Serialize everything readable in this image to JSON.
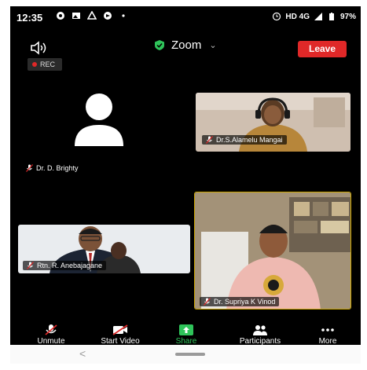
{
  "status_bar": {
    "time": "12:35",
    "right_text": "HD 4G",
    "battery": "97%",
    "icons": [
      "chat-bubble-icon",
      "gallery-icon",
      "drive-icon",
      "send-icon",
      "dot-icon",
      "alarm-icon",
      "signal-icon",
      "battery-icon"
    ]
  },
  "meeting": {
    "title": "Zoom",
    "leave_label": "Leave",
    "rec_label": "REC",
    "accent": "#e02828",
    "shield_color": "#2fc45a"
  },
  "participants": [
    {
      "name": "Dr. D. Brighty",
      "video": false
    },
    {
      "name": "Dr.S.Alamelu Mangai",
      "video": true
    },
    {
      "name": "Rtn. R. Anebajagane",
      "video": true
    },
    {
      "name": "Dr. Supriya K Vinod",
      "video": true,
      "active_speaker": true
    }
  ],
  "toolbar": {
    "unmute": "Unmute",
    "start_video": "Start Video",
    "share": "Share",
    "participants": "Participants",
    "more": "More"
  },
  "navbar": {
    "back": "<"
  }
}
